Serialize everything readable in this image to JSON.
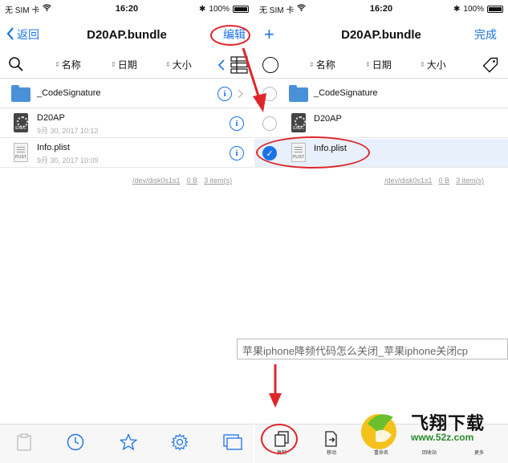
{
  "left_pane": {
    "status": {
      "carrier": "无 SIM 卡",
      "time": "16:20",
      "battery": "100%"
    },
    "nav": {
      "back_label": "返回",
      "title": "D20AP.bundle",
      "action_label": "编辑"
    },
    "sort": {
      "name": "名称",
      "date": "日期",
      "size": "大小"
    },
    "files": [
      {
        "name": "_CodeSignature",
        "date": ""
      },
      {
        "name": "D20AP",
        "date": "9月 30, 2017 10:12"
      },
      {
        "name": "Info.plist",
        "date": "9月 30, 2017 10:09"
      }
    ],
    "footer": {
      "disk": "/dev/disk0s1s1",
      "size": "0 B",
      "items": "3 item(s)"
    }
  },
  "right_pane": {
    "status": {
      "carrier": "无 SIM 卡",
      "time": "16:20",
      "battery": "100%"
    },
    "nav": {
      "add_label": "+",
      "title": "D20AP.bundle",
      "done_label": "完成"
    },
    "sort": {
      "name": "名称",
      "date": "日期",
      "size": "大小"
    },
    "files": [
      {
        "name": "_CodeSignature",
        "selected": false
      },
      {
        "name": "D20AP",
        "selected": false
      },
      {
        "name": "Info.plist",
        "selected": true
      }
    ],
    "footer": {
      "disk": "/dev/disk0s1s1",
      "size": "0 B",
      "items": "3 item(s)"
    },
    "toolbar": {
      "copy": "复制",
      "move": "移动",
      "rename": "重命名",
      "trash": "回收站",
      "more": "更多"
    }
  },
  "file_icons": {
    "exec_label": "EXEC",
    "plist_label": "PLIST"
  },
  "watermark": {
    "caption": "苹果iphone降频代码怎么关闭_苹果iphone关闭cp",
    "logo_text": "飞翔下载",
    "logo_url": "www.52z.com"
  },
  "colors": {
    "accent": "#1a73e8",
    "annotation": "#e0262a"
  }
}
